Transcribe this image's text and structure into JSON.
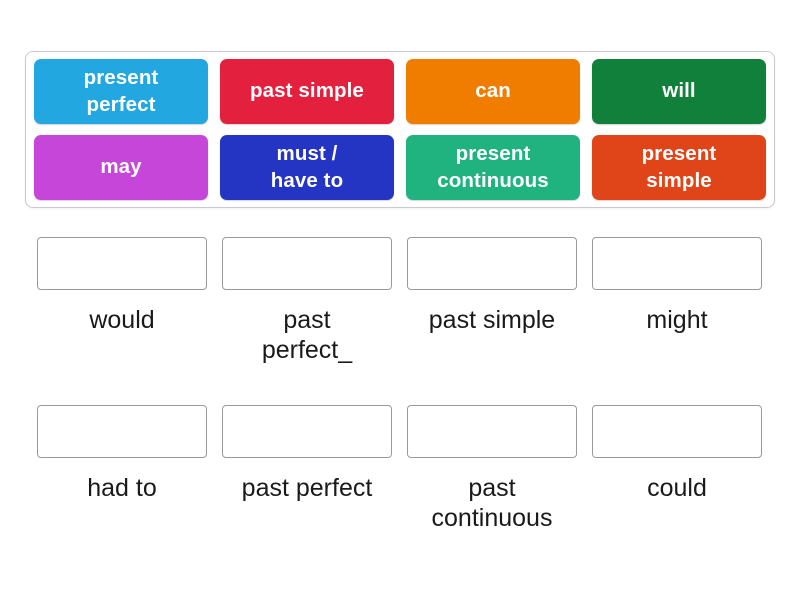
{
  "page": {
    "background_color": "#ffffff",
    "activity_type": "match-up-drag-and-drop"
  },
  "tile_tray": {
    "name": "draggable-tiles-tray",
    "border_color": "#c9c9d2",
    "tiles": [
      {
        "label": "present\nperfect",
        "color": "#22a7e0",
        "text_color": "#ffffff"
      },
      {
        "label": "past simple",
        "color": "#e3213f",
        "text_color": "#ffffff"
      },
      {
        "label": "can",
        "color": "#f07d00",
        "text_color": "#ffffff"
      },
      {
        "label": "will",
        "color": "#10803a",
        "text_color": "#ffffff"
      },
      {
        "label": "may",
        "color": "#c646da",
        "text_color": "#ffffff"
      },
      {
        "label": "must /\nhave to",
        "color": "#2434c3",
        "text_color": "#ffffff"
      },
      {
        "label": "present\ncontinuous",
        "color": "#20b380",
        "text_color": "#ffffff"
      },
      {
        "label": "present\nsimple",
        "color": "#e0451a",
        "text_color": "#ffffff"
      }
    ]
  },
  "answer_rows": [
    {
      "name": "answer-row-1",
      "slots": [
        {
          "label": "would",
          "drop_zone_value": ""
        },
        {
          "label": "past\nperfect_",
          "drop_zone_value": ""
        },
        {
          "label": "past simple",
          "drop_zone_value": ""
        },
        {
          "label": "might",
          "drop_zone_value": ""
        }
      ]
    },
    {
      "name": "answer-row-2",
      "slots": [
        {
          "label": "had to",
          "drop_zone_value": ""
        },
        {
          "label": "past perfect",
          "drop_zone_value": ""
        },
        {
          "label": "past\ncontinuous",
          "drop_zone_value": ""
        },
        {
          "label": "could",
          "drop_zone_value": ""
        }
      ]
    }
  ]
}
